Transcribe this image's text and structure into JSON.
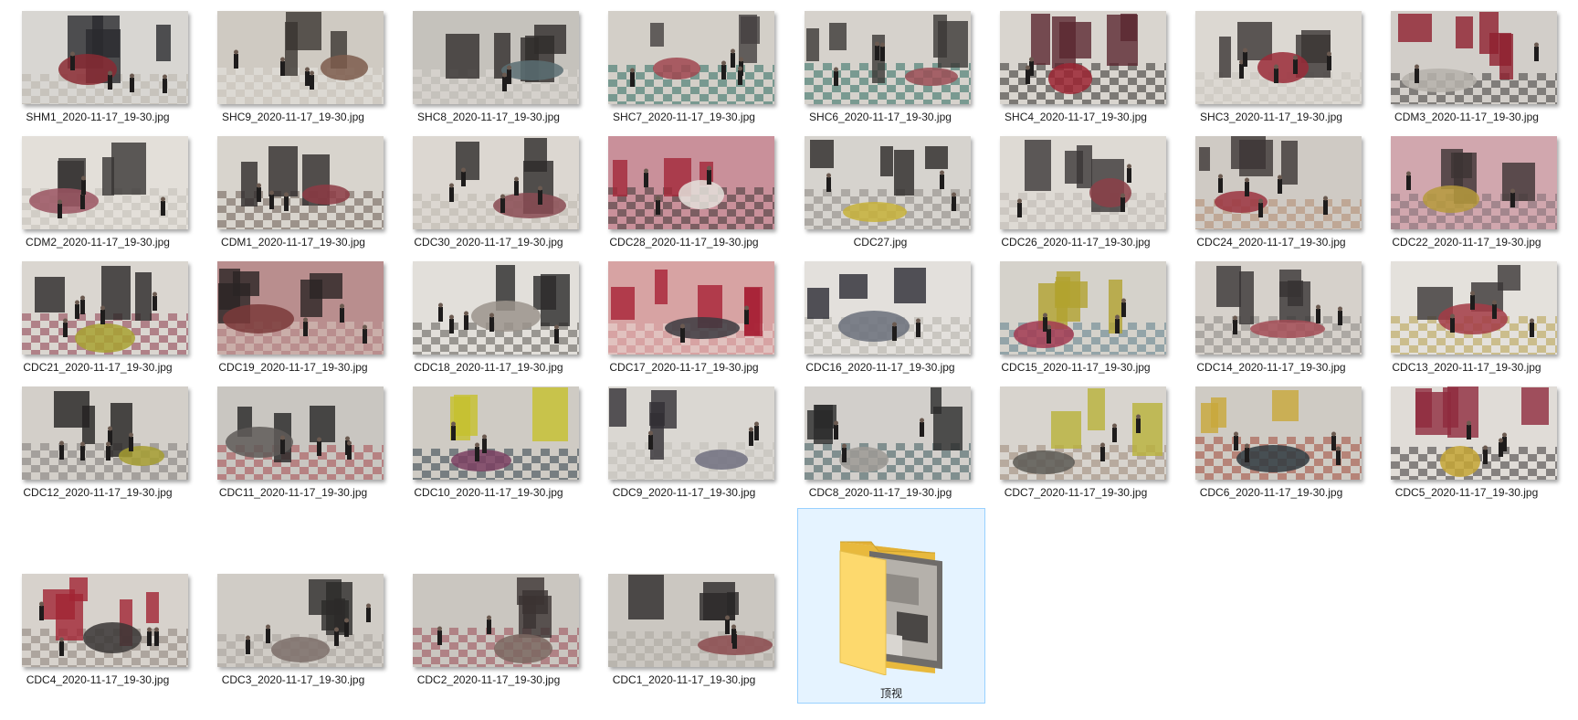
{
  "files": [
    {
      "name": "SHM1_2020-11-17_19-30.jpg",
      "palette": [
        "#d8d6d2",
        "#2b2b2e",
        "#8a2a33",
        "#b9b4aa"
      ]
    },
    {
      "name": "SHC9_2020-11-17_19-30.jpg",
      "palette": [
        "#cfcac2",
        "#3a3431",
        "#7d5c4c",
        "#e8e6e2"
      ]
    },
    {
      "name": "SHC8_2020-11-17_19-30.jpg",
      "palette": [
        "#c5c2bc",
        "#2f2c2a",
        "#5a6f73",
        "#e1ded8"
      ]
    },
    {
      "name": "SHC7_2020-11-17_19-30.jpg",
      "palette": [
        "#d3cfc8",
        "#454040",
        "#a04650",
        "#2e6e62"
      ]
    },
    {
      "name": "SHC6_2020-11-17_19-30.jpg",
      "palette": [
        "#d6d2cc",
        "#3b3836",
        "#9b4d55",
        "#2d6b60"
      ]
    },
    {
      "name": "SHC4_2020-11-17_19-30.jpg",
      "palette": [
        "#d9d5cf",
        "#5a2730",
        "#9b2433",
        "#302d2c"
      ]
    },
    {
      "name": "SHC3_2020-11-17_19-30.jpg",
      "palette": [
        "#dcd8d2",
        "#3a3433",
        "#9a2b38",
        "#c9c4bc"
      ]
    },
    {
      "name": "CDM3_2020-11-17_19-30.jpg",
      "palette": [
        "#d2cec9",
        "#8e1f2e",
        "#b6b2ac",
        "#3c3a38"
      ]
    },
    {
      "name": "CDM2_2020-11-17_19-30.jpg",
      "palette": [
        "#e3dfd9",
        "#373433",
        "#9b5561",
        "#c3beb6"
      ]
    },
    {
      "name": "CDM1_2020-11-17_19-30.jpg",
      "palette": [
        "#d8d4cd",
        "#2f2b2a",
        "#8d3b44",
        "#6b5b53"
      ]
    },
    {
      "name": "CDC30_2020-11-17_19-30.jpg",
      "palette": [
        "#dcd7d1",
        "#2d2a29",
        "#8a4b53",
        "#bcb6ad"
      ]
    },
    {
      "name": "CDC28_2020-11-17_19-30.jpg",
      "palette": [
        "#c9909a",
        "#a22738",
        "#e4e0da",
        "#3d3534"
      ]
    },
    {
      "name": "CDC27.jpg",
      "palette": [
        "#d6d3ce",
        "#2a2827",
        "#c7b23a",
        "#8c8782"
      ]
    },
    {
      "name": "CDC26_2020-11-17_19-30.jpg",
      "palette": [
        "#dedad4",
        "#3a3636",
        "#8c3f48",
        "#bdb8b0"
      ]
    },
    {
      "name": "CDC24_2020-11-17_19-30.jpg",
      "palette": [
        "#cfcac4",
        "#3b3534",
        "#9b3440",
        "#b28a70"
      ]
    },
    {
      "name": "CDC22_2020-11-17_19-30.jpg",
      "palette": [
        "#d1a7ae",
        "#3c3333",
        "#b69a3c",
        "#7d6c72"
      ]
    },
    {
      "name": "CDC21_2020-11-17_19-30.jpg",
      "palette": [
        "#dad6d0",
        "#292727",
        "#a8a233",
        "#8e3c4c"
      ]
    },
    {
      "name": "CDC19_2020-11-17_19-30.jpg",
      "palette": [
        "#b98e8e",
        "#2a2424",
        "#7a3a3a",
        "#d9c9bf"
      ]
    },
    {
      "name": "CDC18_2020-11-17_19-30.jpg",
      "palette": [
        "#e2dfda",
        "#2b2929",
        "#9b948c",
        "#5d5956"
      ]
    },
    {
      "name": "CDC17_2020-11-17_19-30.jpg",
      "palette": [
        "#d7a3a3",
        "#a82134",
        "#3b3a40",
        "#e9dcd7"
      ]
    },
    {
      "name": "CDC16_2020-11-17_19-30.jpg",
      "palette": [
        "#e3e0dc",
        "#2a2b33",
        "#6a6f7a",
        "#b4b0aa"
      ]
    },
    {
      "name": "CDC15_2020-11-17_19-30.jpg",
      "palette": [
        "#d5d2cb",
        "#b1a22f",
        "#a23b52",
        "#5d7e8c"
      ]
    },
    {
      "name": "CDC14_2020-11-17_19-30.jpg",
      "palette": [
        "#d6d1cb",
        "#373333",
        "#a34c56",
        "#8b8783"
      ]
    },
    {
      "name": "CDC13_2020-11-17_19-30.jpg",
      "palette": [
        "#e4e1dc",
        "#3a3636",
        "#a33b45",
        "#b7a04a"
      ]
    },
    {
      "name": "CDC12_2020-11-17_19-30.jpg",
      "palette": [
        "#d3cfc9",
        "#232121",
        "#a69e31",
        "#7e7a76"
      ]
    },
    {
      "name": "CDC11_2020-11-17_19-30.jpg",
      "palette": [
        "#c9c6c1",
        "#262424",
        "#5f5b58",
        "#a64a4e"
      ]
    },
    {
      "name": "CDC10_2020-11-17_19-30.jpg",
      "palette": [
        "#cfcbc4",
        "#c6c12d",
        "#7a3f62",
        "#2f3f4a"
      ]
    },
    {
      "name": "CDC9_2020-11-17_19-30.jpg",
      "palette": [
        "#dad7d2",
        "#323034",
        "#707080",
        "#c1bdb6"
      ]
    },
    {
      "name": "CDC8_2020-11-17_19-30.jpg",
      "palette": [
        "#d2cfcb",
        "#2b2a2b",
        "#9d9a95",
        "#3d5b5e"
      ]
    },
    {
      "name": "CDC7_2020-11-17_19-30.jpg",
      "palette": [
        "#d8d4ce",
        "#b9b13a",
        "#5c5954",
        "#9d8776"
      ]
    },
    {
      "name": "CDC6_2020-11-17_19-30.jpg",
      "palette": [
        "#cfcbc4",
        "#c8a83a",
        "#2f3a3f",
        "#a24a3a"
      ]
    },
    {
      "name": "CDC5_2020-11-17_19-30.jpg",
      "palette": [
        "#e0dcd7",
        "#8e2a3d",
        "#c4a636",
        "#3a3636"
      ]
    },
    {
      "name": "CDC4_2020-11-17_19-30.jpg",
      "palette": [
        "#d7d2cc",
        "#a12433",
        "#3a3635",
        "#8a7f78"
      ]
    },
    {
      "name": "CDC3_2020-11-17_19-30.jpg",
      "palette": [
        "#d0ccc6",
        "#2c2a29",
        "#7c6f6a",
        "#a6a19a"
      ]
    },
    {
      "name": "CDC2_2020-11-17_19-30.jpg",
      "palette": [
        "#cac6c0",
        "#3b3332",
        "#7b6760",
        "#9a4a54"
      ]
    },
    {
      "name": "CDC1_2020-11-17_19-30.jpg",
      "palette": [
        "#cbc7c1",
        "#2a2828",
        "#8b4a4e",
        "#aba59e"
      ]
    }
  ],
  "folder": {
    "name": "顶视",
    "icon": "folder-icon",
    "selected": true,
    "colors": {
      "front": "#fdd96d",
      "back": "#e8b93d",
      "selection_border": "#99d1ff",
      "selection_fill": "#e5f3ff"
    }
  }
}
